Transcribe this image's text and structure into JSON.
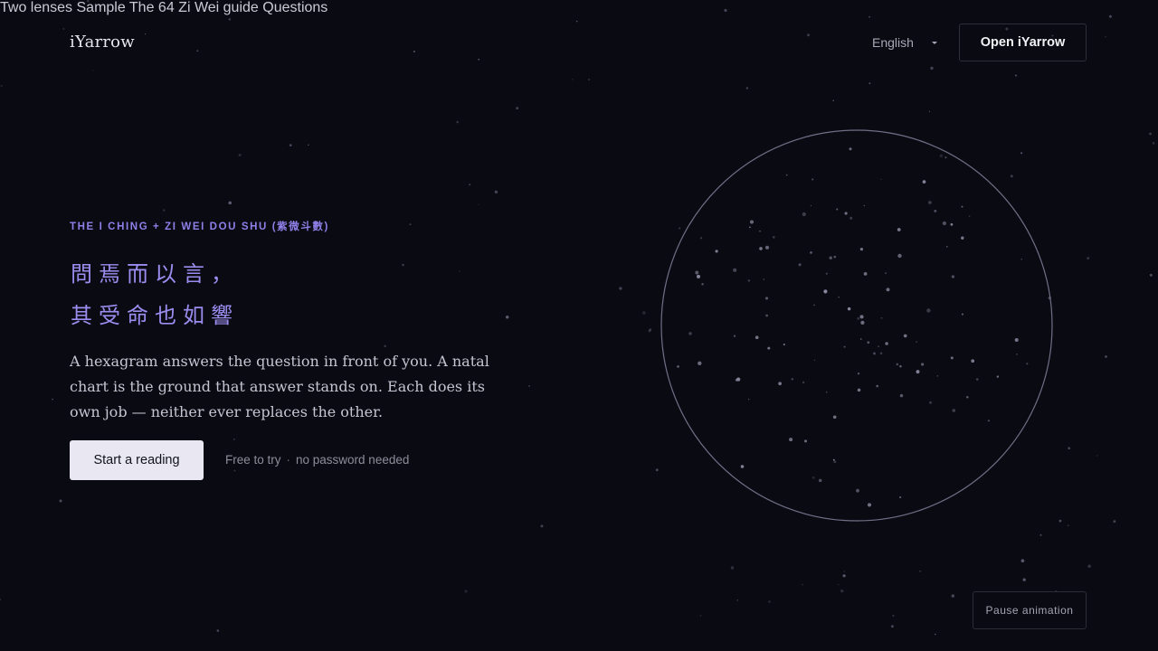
{
  "brand": {
    "logo": "iYarrow"
  },
  "nav": {
    "items": [
      {
        "label": "Two lenses"
      },
      {
        "label": "Sample"
      },
      {
        "label": "The 64"
      },
      {
        "label": "Zi Wei guide"
      },
      {
        "label": "Questions"
      }
    ],
    "language": "English",
    "open_button": "Open iYarrow"
  },
  "hero": {
    "eyebrow": "THE I CHING + ZI WEI DOU SHU (紫微斗數)",
    "poem": [
      "問焉而以言，",
      "其受命也如響"
    ],
    "lede": "A hexagram answers the question in front of you. A natal chart is the ground that answer stands on. Each does its own job — neither ever replaces the other.",
    "cta": "Start a reading",
    "note_a": "Free to try",
    "note_sep": "·",
    "note_b": "no password needed"
  },
  "controls": {
    "pause": "Pause animation"
  },
  "colors": {
    "background": "#0a0b12",
    "accent": "#9b8cf0",
    "button": "#e8e7f2"
  },
  "icons": {
    "language_caret": "chevron-down-icon"
  }
}
